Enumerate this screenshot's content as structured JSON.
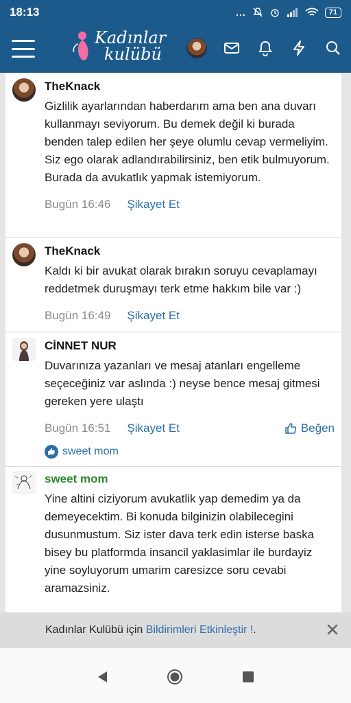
{
  "status_bar": {
    "time": "18:13",
    "dots": "...",
    "battery": "71"
  },
  "header": {
    "logo_line1": "Kadınlar",
    "logo_line2": "kulübü"
  },
  "comments": [
    {
      "author": "TheKnack",
      "text": "Gizlilik ayarlarından haberdarım ama ben ana duvarı kullanmayı seviyorum. Bu demek değil ki burada benden talep edilen her şeye olumlu cevap vermeliyim. Siz ego olarak adlandırabilirsiniz, ben etik bulmuyorum. Burada da avukatlık yapmak istemiyorum.",
      "time": "Bugün 16:46",
      "report": "Şikayet Et"
    },
    {
      "author": "TheKnack",
      "text": "Kaldı ki bir avukat olarak bırakın soruyu cevaplamayı reddetmek duruşmayı terk etme hakkım bile var :)",
      "time": "Bugün 16:49",
      "report": "Şikayet Et"
    },
    {
      "author": "CİNNET NUR",
      "text": "Duvarınıza yazanları ve mesaj atanları engelleme seçeceğiniz var aslında :) neyse bence mesaj gitmesi gereken yere ulaştı",
      "time": "Bugün 16:51",
      "report": "Şikayet Et",
      "like": "Beğen",
      "reaction_user": "sweet mom"
    },
    {
      "author": "sweet mom",
      "text": "Yine altini ciziyorum avukatlik yap demedim ya da demeyecektim. Bi konuda bilginizin olabilecegini dusunmustum. Siz ister dava terk edin isterse baska bisey bu platformda insancil yaklasimlar ile burdayiz yine soyluyorum umarim caresizce soru cevabi aramazsiniz."
    }
  ],
  "notification": {
    "prefix": "Kadınlar Kulübü için ",
    "link": "Bildirimleri Etkinleştir !",
    "suffix": "."
  },
  "colors": {
    "brand": "#1d5a8c",
    "link": "#2b6ea8",
    "author_highlight": "#2e8b2e"
  }
}
